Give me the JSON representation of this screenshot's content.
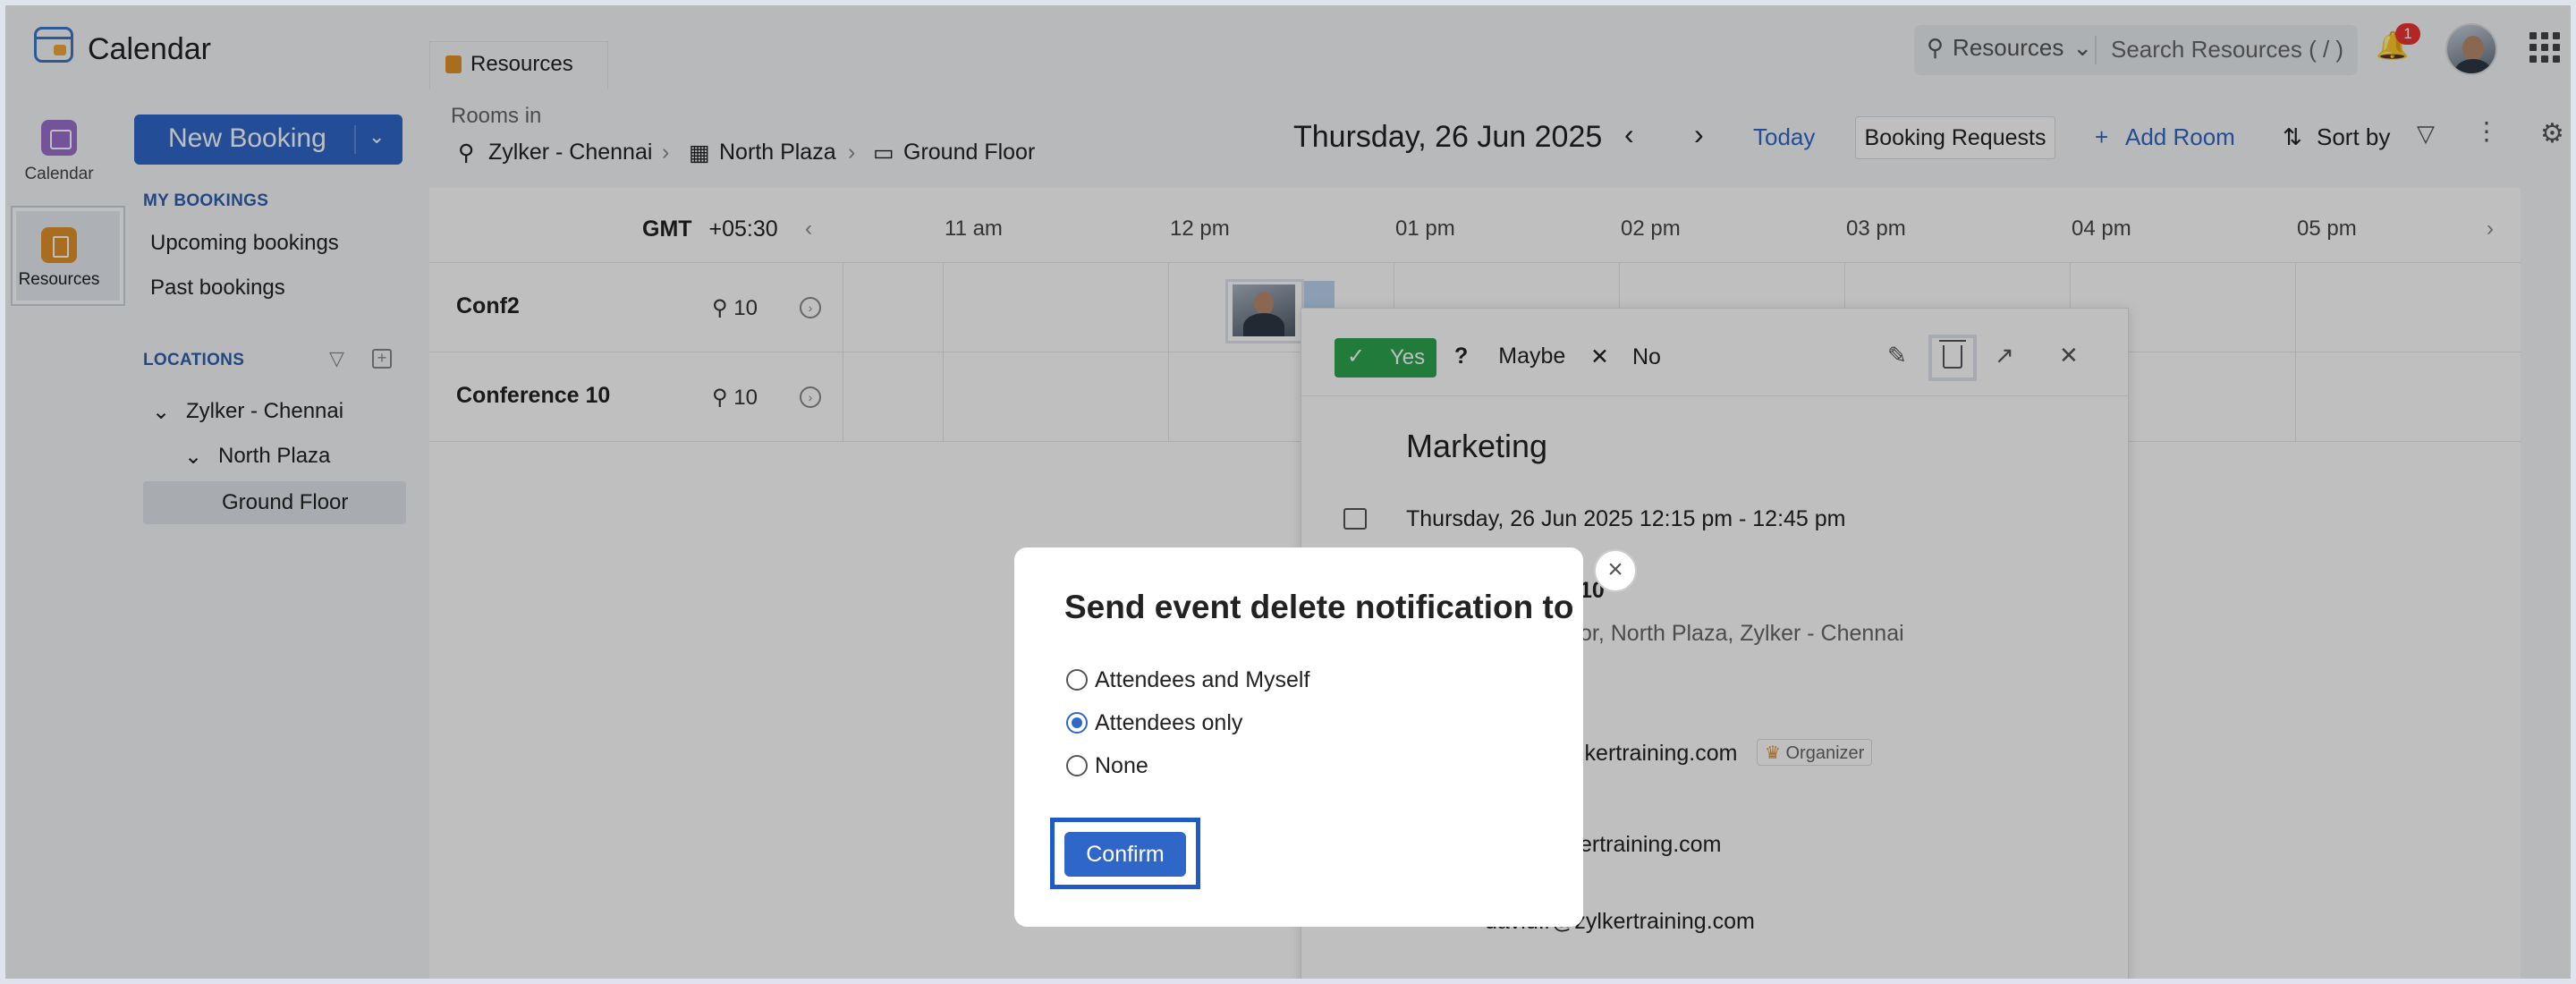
{
  "app": {
    "title": "Calendar"
  },
  "topbar": {
    "search_scope": "Resources",
    "search_placeholder": "Search Resources ( / )",
    "notification_count": "1"
  },
  "rail": {
    "items": [
      {
        "label": "Calendar",
        "icon": "calendar-icon"
      },
      {
        "label": "Resources",
        "icon": "resources-icon"
      }
    ]
  },
  "side": {
    "new_booking": "New Booking",
    "my_bookings_head": "MY BOOKINGS",
    "links": [
      "Upcoming bookings",
      "Past bookings"
    ],
    "locations_head": "LOCATIONS",
    "tree": [
      "Zylker - Chennai",
      "North Plaza",
      "Ground Floor"
    ]
  },
  "main": {
    "tab": "Resources",
    "rooms_in": "Rooms in",
    "breadcrumb": [
      "Zylker - Chennai",
      "North Plaza",
      "Ground Floor"
    ],
    "date": "Thursday, 26 Jun 2025",
    "today": "Today",
    "booking_requests": "Booking Requests",
    "add_room": "Add Room",
    "sort_by": "Sort by"
  },
  "timeline": {
    "gmt_label": "GMT",
    "gmt_offset": "+05:30",
    "hours": [
      "11 am",
      "12 pm",
      "01 pm",
      "02 pm",
      "03 pm",
      "04 pm",
      "05 pm"
    ],
    "rooms": [
      {
        "name": "Conf2",
        "capacity": "10"
      },
      {
        "name": "Conference 10",
        "capacity": "10"
      }
    ]
  },
  "event_card": {
    "yes": "Yes",
    "maybe": "Maybe",
    "no": "No",
    "title": "Marketing",
    "datetime": "Thursday, 26 Jun 2025 12:15 pm - 12:45 pm",
    "room_partial": "10",
    "location_partial": "or, North Plaza, Zylker - Chennai",
    "email1_partial": "lkertraining.com",
    "organizer_badge": "Organizer",
    "email2_partial": "ertraining.com",
    "email3_partial": "david.r@zylkertraining.com"
  },
  "modal": {
    "title": "Send event delete notification to",
    "options": [
      "Attendees and Myself",
      "Attendees only",
      "None"
    ],
    "selected_index": 1,
    "confirm": "Confirm"
  },
  "colors": {
    "accent": "#2f67c8",
    "yes_green": "#2da44e",
    "resources_orange": "#e19228",
    "calendar_purple": "#9b6fce"
  }
}
